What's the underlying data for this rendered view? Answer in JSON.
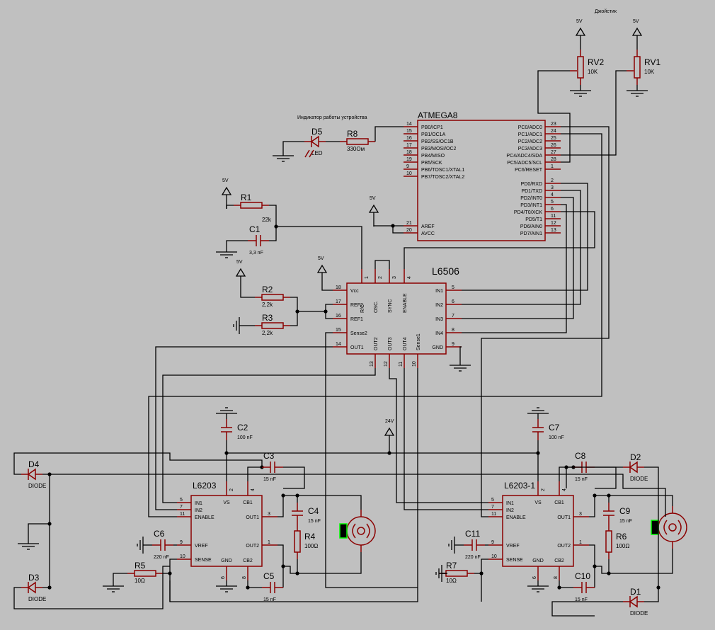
{
  "annotations": {
    "joystick": "Джойстик",
    "indicator": "Индикатор работы устройства"
  },
  "power": {
    "v5": "5V",
    "v24": "24V"
  },
  "colors": {
    "background": "#c0c0c0",
    "component": "#8b0000",
    "wire": "#000000",
    "probe": "#00ff00"
  },
  "components": {
    "RV1": {
      "ref": "RV1",
      "value": "10K"
    },
    "RV2": {
      "ref": "RV2",
      "value": "10K"
    },
    "R1": {
      "ref": "R1",
      "value": "22k"
    },
    "C1": {
      "ref": "C1",
      "value": "3,3 nF"
    },
    "R2": {
      "ref": "R2",
      "value": "2,2k"
    },
    "R3": {
      "ref": "R3",
      "value": "2,2k"
    },
    "R8": {
      "ref": "R8",
      "value": "330Ом"
    },
    "D5": {
      "ref": "D5",
      "value": "LED"
    },
    "C2": {
      "ref": "C2",
      "value": "100 nF"
    },
    "C3": {
      "ref": "C3",
      "value": "15 nF"
    },
    "C4": {
      "ref": "C4",
      "value": "15 nF"
    },
    "C5": {
      "ref": "C5",
      "value": "15 nF"
    },
    "C6": {
      "ref": "C6",
      "value": "220 nF"
    },
    "R4": {
      "ref": "R4",
      "value": "100Ω"
    },
    "R5": {
      "ref": "R5",
      "value": "10Ω"
    },
    "D3": {
      "ref": "D3",
      "value": "DIODE"
    },
    "D4": {
      "ref": "D4",
      "value": "DIODE"
    },
    "C7": {
      "ref": "C7",
      "value": "100 nF"
    },
    "C8": {
      "ref": "C8",
      "value": "15 nF"
    },
    "C9": {
      "ref": "C9",
      "value": "15 nF"
    },
    "C10": {
      "ref": "C10",
      "value": "15 nF"
    },
    "C11": {
      "ref": "C11",
      "value": "220 nF"
    },
    "R6": {
      "ref": "R6",
      "value": "100Ω"
    },
    "R7": {
      "ref": "R7",
      "value": "10Ω"
    },
    "D1": {
      "ref": "D1",
      "value": "DIODE"
    },
    "D2": {
      "ref": "D2",
      "value": "DIODE"
    }
  },
  "chips": {
    "atmega": {
      "title": "ATMEGA8",
      "pins": [
        {
          "num": "14",
          "name": "PB0/ICP1"
        },
        {
          "num": "15",
          "name": "PB1/OC1A"
        },
        {
          "num": "16",
          "name": "PB2/SS/OC1B"
        },
        {
          "num": "17",
          "name": "PB3/MOSI/OC2"
        },
        {
          "num": "18",
          "name": "PB4/MISO"
        },
        {
          "num": "19",
          "name": "PB5/SCK"
        },
        {
          "num": "9",
          "name": "PB6/TOSC1/XTAL1"
        },
        {
          "num": "10",
          "name": "PB7/TOSC2/XTAL2"
        },
        {
          "num": "21",
          "name": "AREF"
        },
        {
          "num": "20",
          "name": "AVCC"
        },
        {
          "num": "23",
          "name": "PC0/ADC0"
        },
        {
          "num": "24",
          "name": "PC1/ADC1"
        },
        {
          "num": "25",
          "name": "PC2/ADC2"
        },
        {
          "num": "26",
          "name": "PC3/ADC3"
        },
        {
          "num": "27",
          "name": "PC4/ADC4/SDA"
        },
        {
          "num": "28",
          "name": "PC5/ADC5/SCL"
        },
        {
          "num": "1",
          "name": "PC6/RESET"
        },
        {
          "num": "2",
          "name": "PD0/RXD"
        },
        {
          "num": "3",
          "name": "PD1/TXD"
        },
        {
          "num": "4",
          "name": "PD2/INT0"
        },
        {
          "num": "5",
          "name": "PD3/INT1"
        },
        {
          "num": "6",
          "name": "PD4/T0/XCK"
        },
        {
          "num": "11",
          "name": "PD5/T1"
        },
        {
          "num": "12",
          "name": "PD6/AIN0"
        },
        {
          "num": "13",
          "name": "PD7/AIN1"
        }
      ]
    },
    "l6506": {
      "title": "L6506",
      "pins": [
        {
          "num": "1",
          "name": "R/C"
        },
        {
          "num": "2",
          "name": "OSC."
        },
        {
          "num": "3",
          "name": "SYNC"
        },
        {
          "num": "4",
          "name": "ENABLE"
        },
        {
          "num": "18",
          "name": "Vcc"
        },
        {
          "num": "17",
          "name": "REF2"
        },
        {
          "num": "16",
          "name": "REF1"
        },
        {
          "num": "15",
          "name": "Sense2"
        },
        {
          "num": "14",
          "name": "OUT1"
        },
        {
          "num": "5",
          "name": "IN1"
        },
        {
          "num": "6",
          "name": "IN2"
        },
        {
          "num": "7",
          "name": "IN3"
        },
        {
          "num": "8",
          "name": "IN4"
        },
        {
          "num": "9",
          "name": "GND"
        },
        {
          "num": "13",
          "name": "OUT2"
        },
        {
          "num": "12",
          "name": "OUT3"
        },
        {
          "num": "11",
          "name": "OUT4"
        },
        {
          "num": "10",
          "name": "Sense1"
        }
      ]
    },
    "l6203": {
      "title": "L6203",
      "pins": [
        {
          "num": "5",
          "name": "IN1"
        },
        {
          "num": "7",
          "name": "IN2"
        },
        {
          "num": "11",
          "name": "ENABLE"
        },
        {
          "num": "9",
          "name": "VREF"
        },
        {
          "num": "10",
          "name": "SENSE"
        },
        {
          "num": "2",
          "name": "VS"
        },
        {
          "num": "4",
          "name": "CB1"
        },
        {
          "num": "3",
          "name": "OUT1"
        },
        {
          "num": "1",
          "name": "OUT2"
        },
        {
          "num": "6",
          "name": "GND"
        },
        {
          "num": "8",
          "name": "CB2"
        }
      ]
    },
    "l6203_1": {
      "title": "L6203-1",
      "pins": [
        {
          "num": "5",
          "name": "IN1"
        },
        {
          "num": "7",
          "name": "IN2"
        },
        {
          "num": "11",
          "name": "ENABLE"
        },
        {
          "num": "9",
          "name": "VREF"
        },
        {
          "num": "10",
          "name": "SENSE"
        },
        {
          "num": "2",
          "name": "VS"
        },
        {
          "num": "4",
          "name": "CB1"
        },
        {
          "num": "3",
          "name": "OUT1"
        },
        {
          "num": "1",
          "name": "OUT2"
        },
        {
          "num": "6",
          "name": "GND"
        },
        {
          "num": "8",
          "name": "CB2"
        }
      ]
    }
  }
}
